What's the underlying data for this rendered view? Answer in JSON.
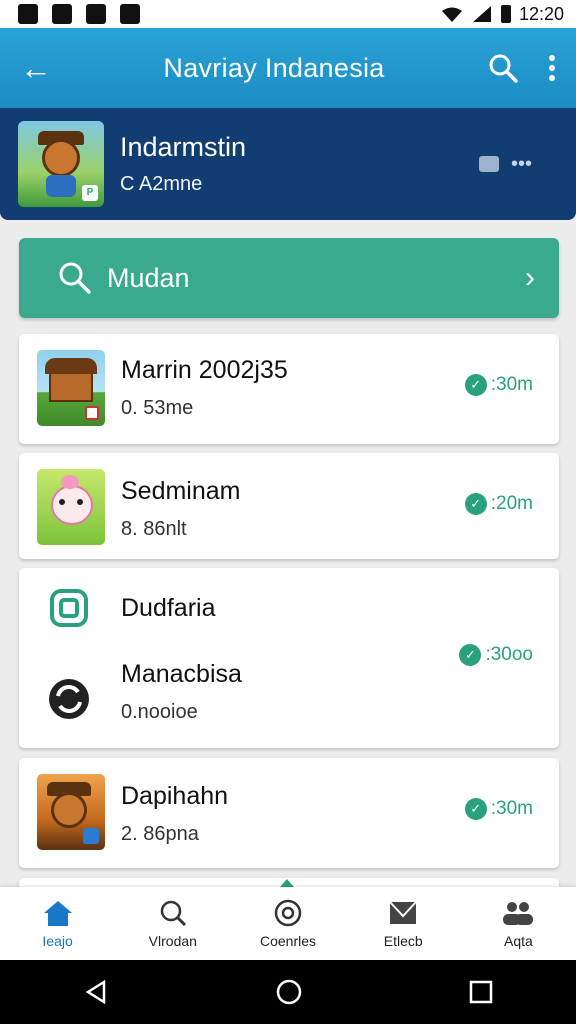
{
  "status": {
    "time": "12:20"
  },
  "appbar": {
    "title": "Navriay Indanesia",
    "back_icon": "arrow-left-icon",
    "search_icon": "search-icon",
    "more_icon": "more-vert-icon"
  },
  "featured": {
    "name": "Indarmstin",
    "sub": "C A2mne"
  },
  "search": {
    "label": "Mudan"
  },
  "cards": [
    {
      "title": "Marrin 2002j35",
      "sub": "0. 53me",
      "time": ":30m"
    },
    {
      "title": "Sedminam",
      "sub": "8. 86nlt",
      "time": ":20m"
    },
    {
      "title": "Dudfaria",
      "title2": "Manacbisa",
      "sub": "0.nooioe",
      "time": ":30oo"
    },
    {
      "title": "Dapihahn",
      "sub": "2. 86pna",
      "time": ":30m"
    }
  ],
  "nav": [
    {
      "label": "Ieajo",
      "icon": "home-icon"
    },
    {
      "label": "Vlrodan",
      "icon": "search-icon"
    },
    {
      "label": "Coenrles",
      "icon": "target-icon"
    },
    {
      "label": "Etlecb",
      "icon": "mail-icon"
    },
    {
      "label": "Aqta",
      "icon": "people-icon"
    }
  ],
  "colors": {
    "appbar": "#1b8dc4",
    "featured": "#123d73",
    "search": "#3aaa8e",
    "accent": "#2aa17d",
    "nav_active": "#1b77c7"
  }
}
